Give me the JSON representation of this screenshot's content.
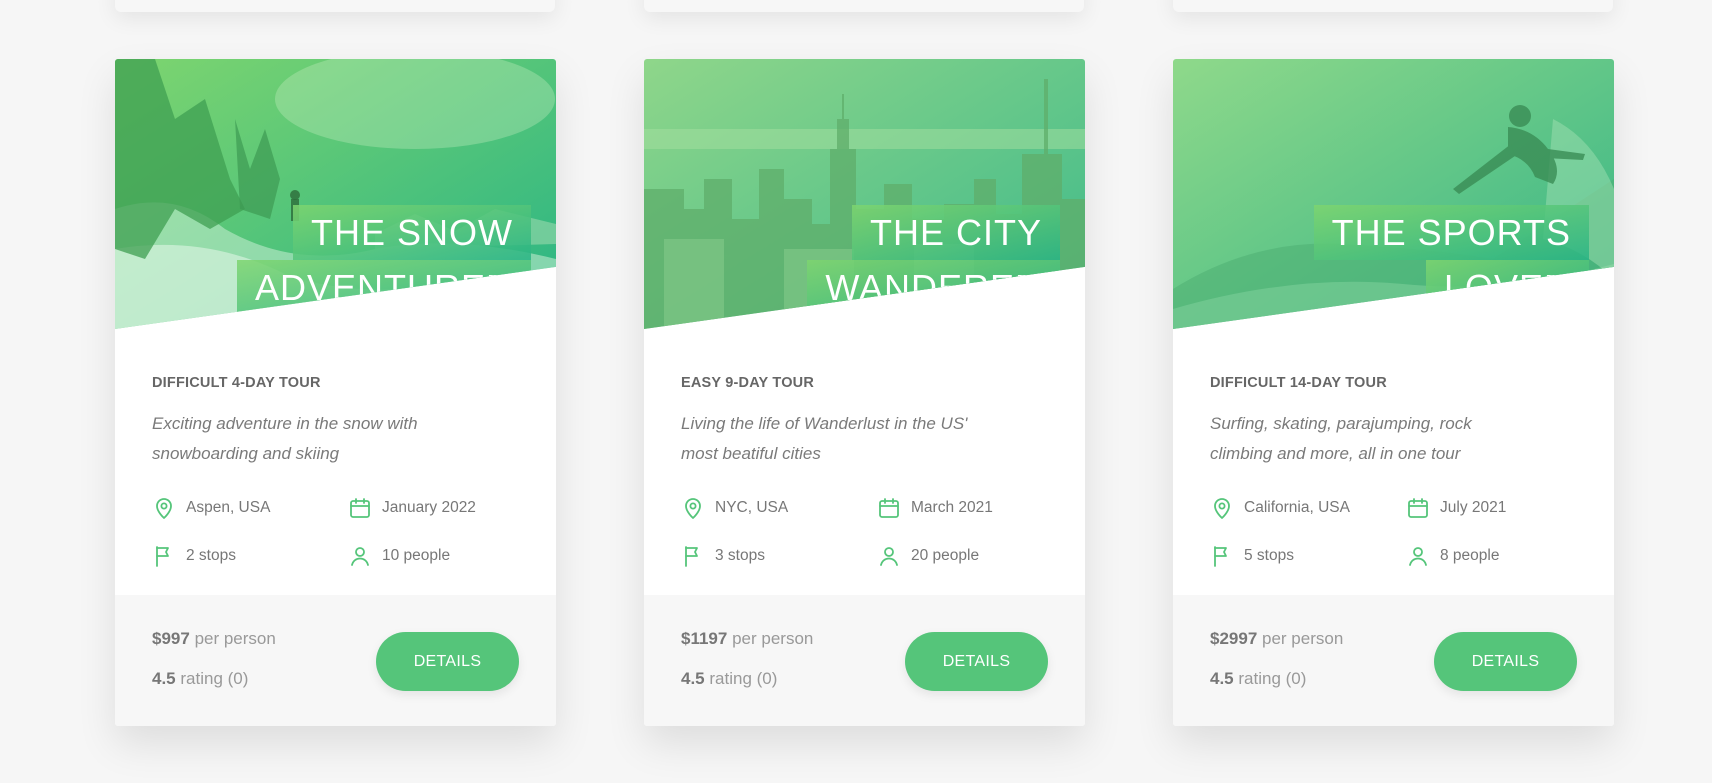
{
  "theme": {
    "accent": "#55c57a",
    "gradient_light": "#7ed56f",
    "gradient_dark": "#28b485"
  },
  "cards": [
    {
      "heading_line1": "THE SNOW",
      "heading_line2": "ADVENTURER",
      "subheading": "DIFFICULT 4-DAY TOUR",
      "summary": "Exciting adventure in the snow with snowboarding and skiing",
      "location": "Aspen, USA",
      "date": "January 2022",
      "stops": "2 stops",
      "people": "10 people",
      "price_value": "$997",
      "price_unit": "per person",
      "rating_value": "4.5",
      "rating_unit": "rating (0)",
      "button": "DETAILS",
      "picture": "snowy-mountain-hiker"
    },
    {
      "heading_line1": "THE CITY",
      "heading_line2": "WANDERER",
      "subheading": "EASY 9-DAY TOUR",
      "summary": "Living the life of Wanderlust in the US' most beatiful cities",
      "location": "NYC, USA",
      "date": "March 2021",
      "stops": "3 stops",
      "people": "20 people",
      "price_value": "$1197",
      "price_unit": "per person",
      "rating_value": "4.5",
      "rating_unit": "rating (0)",
      "button": "DETAILS",
      "picture": "city-skyline"
    },
    {
      "heading_line1": "THE SPORTS",
      "heading_line2": "LOVER",
      "subheading": "DIFFICULT 14-DAY TOUR",
      "summary": "Surfing, skating, parajumping, rock climbing and more, all in one tour",
      "location": "California, USA",
      "date": "July 2021",
      "stops": "5 stops",
      "people": "8 people",
      "price_value": "$2997",
      "price_unit": "per person",
      "rating_value": "4.5",
      "rating_unit": "rating (0)",
      "button": "DETAILS",
      "picture": "surfer-on-wave"
    }
  ],
  "icons": {
    "location": "map-pin-icon",
    "date": "calendar-icon",
    "stops": "flag-icon",
    "people": "user-icon"
  }
}
